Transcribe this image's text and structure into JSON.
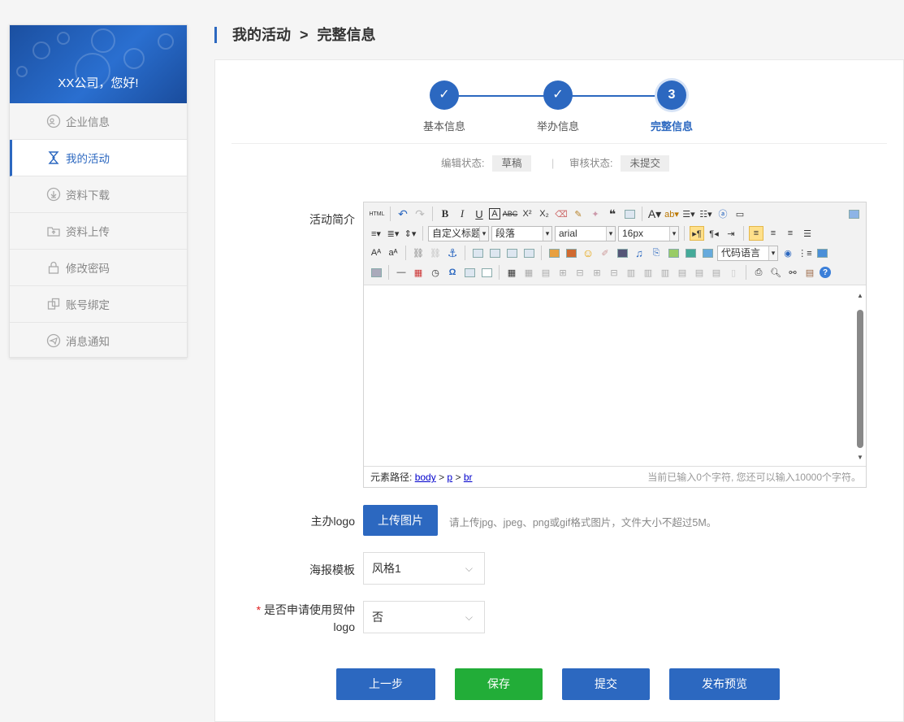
{
  "sidebar": {
    "greeting": "XX公司，您好!",
    "items": [
      {
        "label": "企业信息",
        "icon": "company-icon"
      },
      {
        "label": "我的活动",
        "icon": "activity-icon"
      },
      {
        "label": "资料下载",
        "icon": "download-icon"
      },
      {
        "label": "资料上传",
        "icon": "upload-icon"
      },
      {
        "label": "修改密码",
        "icon": "lock-icon"
      },
      {
        "label": "账号绑定",
        "icon": "link-icon"
      },
      {
        "label": "消息通知",
        "icon": "message-icon"
      }
    ],
    "active_index": 1
  },
  "page": {
    "breadcrumb_parent": "我的活动",
    "breadcrumb_sep": ">",
    "breadcrumb_current": "完整信息"
  },
  "steps": [
    {
      "label": "基本信息",
      "mark": "✓"
    },
    {
      "label": "举办信息",
      "mark": "✓"
    },
    {
      "label": "完整信息",
      "mark": "3"
    }
  ],
  "status": {
    "edit_label": "编辑状态:",
    "edit_value": "草稿",
    "divider": "|",
    "review_label": "审核状态:",
    "review_value": "未提交"
  },
  "form": {
    "intro_label": "活动简介",
    "editor": {
      "font_style": "自定义标题",
      "paragraph": "段落",
      "font_family": "arial",
      "font_size": "16px",
      "code_lang": "代码语言",
      "path_label": "元素路径:",
      "path": [
        "body",
        "p",
        "br"
      ],
      "path_sep": ">",
      "counter": "当前已输入0个字符, 您还可以输入10000个字符。"
    },
    "logo_label": "主办logo",
    "upload_button": "上传图片",
    "upload_hint": "请上传jpg、jpeg、png或gif格式图片，文件大小不超过5M。",
    "poster_label": "海报模板",
    "poster_value": "风格1",
    "apply_required": "*",
    "apply_label_line1": "是否申请使用贸仲",
    "apply_label_line2": "logo",
    "apply_value": "否"
  },
  "actions": {
    "prev": "上一步",
    "save": "保存",
    "submit": "提交",
    "preview": "发布预览"
  },
  "colors": {
    "primary": "#2c68c0",
    "save": "#22ad38",
    "required": "#e02020"
  }
}
